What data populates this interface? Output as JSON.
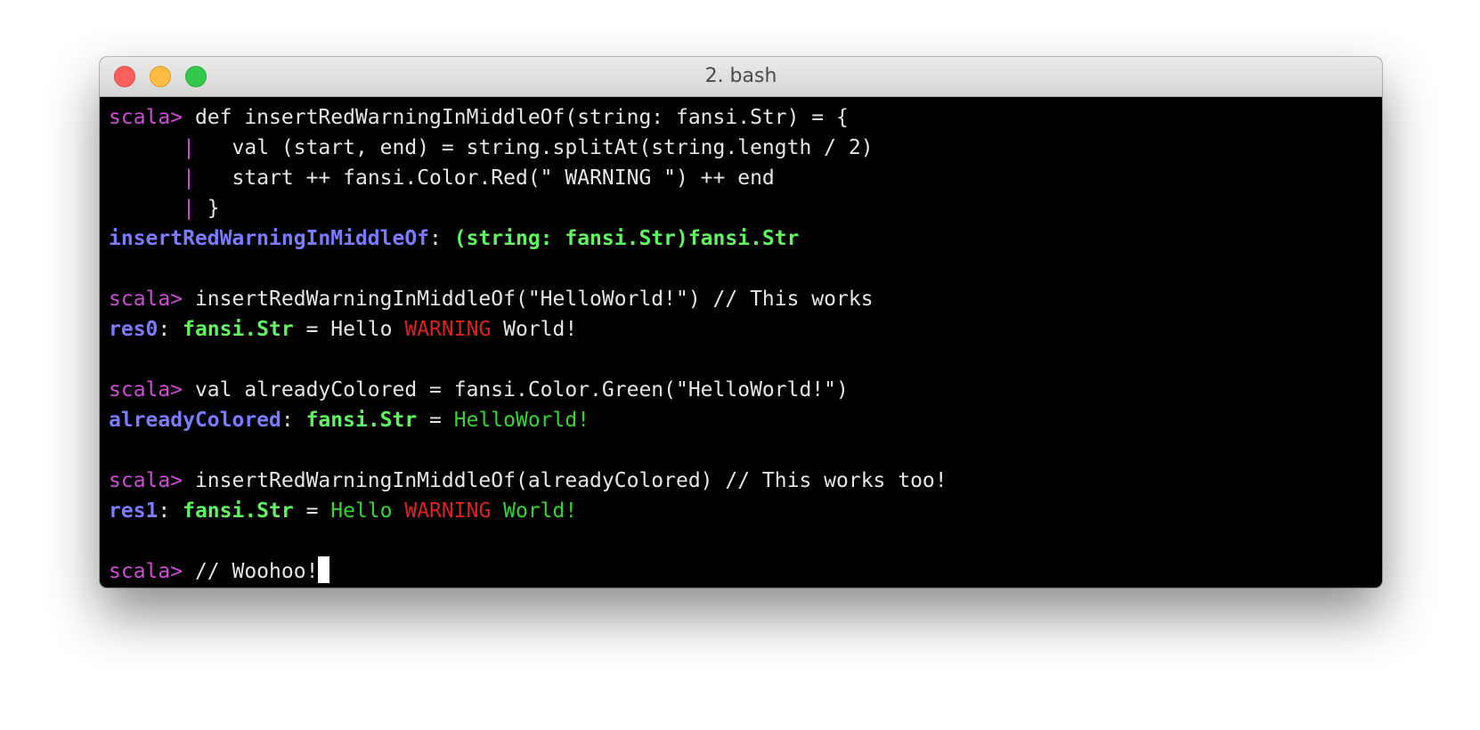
{
  "window": {
    "title": "2. bash"
  },
  "colors": {
    "prompt": "#d04ad8",
    "identifier": "#7b7bff",
    "type": "#5ff55f",
    "red_text": "#e0201c",
    "green_text": "#30d830",
    "background": "#000000",
    "foreground": "#e6e6e6"
  },
  "terminal": {
    "prompt": "scala>",
    "continuation": "|",
    "def_line1": " def insertRedWarningInMiddleOf(string: fansi.Str) = {",
    "def_line2": "   val (start, end) = string.splitAt(string.length / 2)",
    "def_line3": "   start ++ fansi.Color.Red(\" WARNING \") ++ end",
    "def_line4": " }",
    "def_result_name": "insertRedWarningInMiddleOf",
    "def_result_sep": ": ",
    "def_result_type": "(string: fansi.Str)fansi.Str",
    "cmd1": " insertRedWarningInMiddleOf(\"HelloWorld!\") // This works",
    "res0_name": "res0",
    "res_sep": ": ",
    "res_type": "fansi.Str",
    "res_eq": " = ",
    "res0_hello": "Hello ",
    "res0_warning": "WARNING",
    "res0_world": " World!",
    "cmd2": " val alreadyColored = fansi.Color.Green(\"HelloWorld!\")",
    "ac_name": "alreadyColored",
    "ac_value": "HelloWorld!",
    "cmd3": " insertRedWarningInMiddleOf(alreadyColored) // This works too!",
    "res1_name": "res1",
    "res1_hello": "Hello ",
    "res1_warning": "WARNING",
    "res1_world": " World!",
    "cmd4": " // Woohoo!"
  }
}
